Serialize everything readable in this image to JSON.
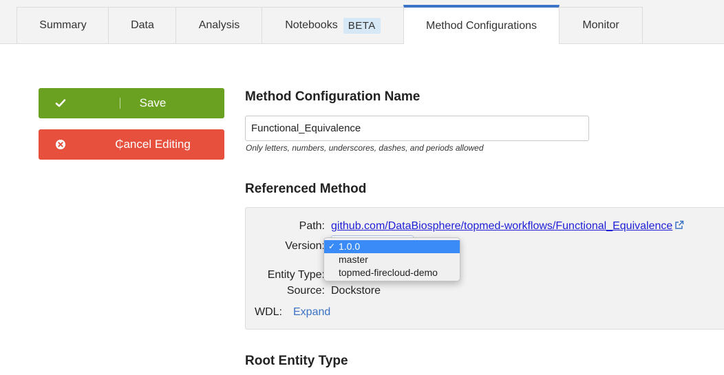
{
  "tabs": [
    {
      "label": "Summary"
    },
    {
      "label": "Data"
    },
    {
      "label": "Analysis"
    },
    {
      "label": "Notebooks",
      "badge": "BETA"
    },
    {
      "label": "Method Configurations"
    },
    {
      "label": "Monitor"
    }
  ],
  "active_tab": "Method Configurations",
  "sidebar": {
    "save_label": "Save",
    "cancel_label": "Cancel Editing"
  },
  "name_section": {
    "heading": "Method Configuration Name",
    "value": "Functional_Equivalence",
    "hint": "Only letters, numbers, underscores, dashes, and periods allowed"
  },
  "method_section": {
    "heading": "Referenced Method",
    "path_label": "Path:",
    "path_value": "github.com/DataBiosphere/topmed-workflows/Functional_Equivalence",
    "version_label": "Version:",
    "entity_type_label": "Entity Type:",
    "source_label": "Source:",
    "source_value": "Dockstore",
    "wdl_label": "WDL:",
    "wdl_expand": "Expand"
  },
  "version_dropdown": {
    "selected": "1.0.0",
    "options": [
      "1.0.0",
      "master",
      "topmed-firecloud-demo"
    ],
    "check_glyph": "✓"
  },
  "root_section": {
    "heading": "Root Entity Type"
  },
  "colors": {
    "save": "#6aa121",
    "cancel": "#e6503c",
    "accent": "#3b73c6",
    "link": "#1d1dd8",
    "selection": "#3a8af7"
  }
}
